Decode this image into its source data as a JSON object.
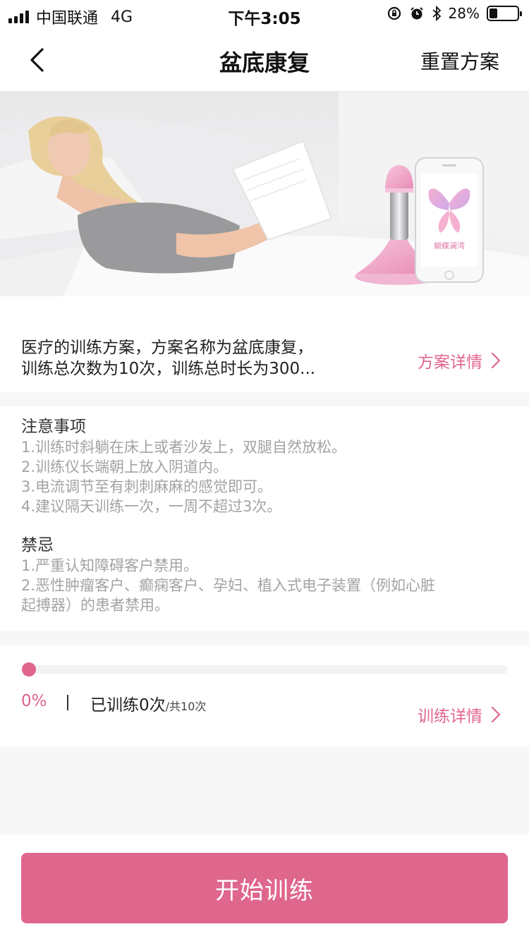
{
  "status_bar": {
    "carrier": "中国联通",
    "network": "4G",
    "time": "下午3:05",
    "battery_percent": "28%",
    "battery_level": 0.28,
    "icons": [
      "signal-icon",
      "rotation-lock-icon",
      "alarm-icon",
      "bluetooth-icon",
      "battery-icon"
    ]
  },
  "nav": {
    "title": "盆底康复",
    "back_icon": "chevron-left-icon",
    "reset_label": "重置方案"
  },
  "banner": {
    "device_logo_text": "蝴蝶澜湾"
  },
  "plan": {
    "description_line1": "医疗的训练方案，方案名称为盆底康复，",
    "description_line2": "训练总次数为10次，训练总时长为300...",
    "detail_link": "方案详情"
  },
  "notes": {
    "title": "注意事项",
    "items": [
      "1.训练时斜躺在床上或者沙发上，双腿自然放松。",
      "2.训练仪长端朝上放入阴道内。",
      "3.电流调节至有刺刺麻麻的感觉即可。",
      "4.建议隔天训练一次，一周不超过3次。"
    ]
  },
  "contraindications": {
    "title": "禁忌",
    "items": [
      "1.严重认知障碍客户禁用。",
      "2.恶性肿瘤客户、癫痫客户、孕妇、植入式电子装置（例如心脏",
      "起搏器）的患者禁用。"
    ]
  },
  "progress": {
    "value": 0,
    "percent_label": "0%",
    "trained_label": "已训练0次",
    "total_label": "/共10次",
    "detail_link": "训练详情"
  },
  "actions": {
    "start_label": "开始训练"
  },
  "colors": {
    "accent": "#e0668c",
    "button": "#df668c",
    "muted_text": "#a3a3a3",
    "background": "#f7f7f7"
  }
}
